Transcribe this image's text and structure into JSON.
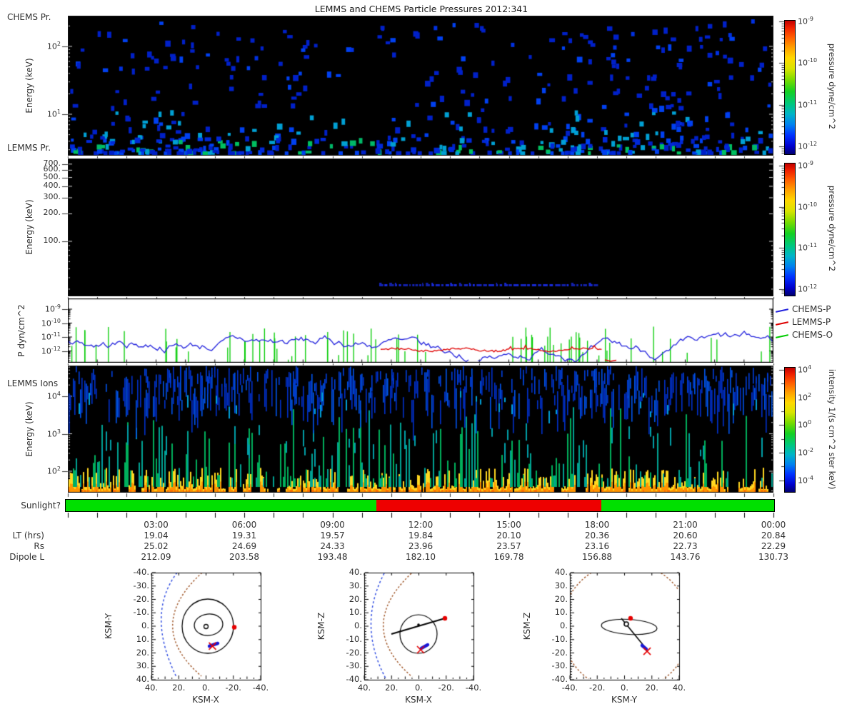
{
  "title": "LEMMS and CHEMS Particle Pressures  2012:341",
  "panels": {
    "p1": {
      "name": "CHEMS Pr.",
      "ylabel": "Energy (keV)",
      "yticks": [
        {
          "label": "10^2",
          "lg": 2
        },
        {
          "label": "10^1",
          "lg": 1
        }
      ]
    },
    "p2": {
      "name": "LEMMS Pr.",
      "ylabel": "Energy (keV)",
      "yticks": [
        {
          "label": "700.",
          "E": 700
        },
        {
          "label": "600.",
          "E": 600
        },
        {
          "label": "500.",
          "E": 500
        },
        {
          "label": "400.",
          "E": 400
        },
        {
          "label": "300.",
          "E": 300
        },
        {
          "label": "200.",
          "E": 200
        },
        {
          "label": "100.",
          "E": 100
        }
      ]
    },
    "p3": {
      "ylabel": "P dyn/cm^2",
      "yticks": [
        {
          "label": "10^-9",
          "lg": -9
        },
        {
          "label": "10^-10",
          "lg": -10
        },
        {
          "label": "10^-11",
          "lg": -11
        },
        {
          "label": "10^-12",
          "lg": -12
        }
      ],
      "legend": [
        {
          "label": "CHEMS-P",
          "color": "#2222dd"
        },
        {
          "label": "LEMMS-P",
          "color": "#dd0000"
        },
        {
          "label": "CHEMS-O",
          "color": "#00cc00"
        }
      ]
    },
    "p4": {
      "name": "LEMMS Ions",
      "ylabel": "Energy (keV)",
      "yticks": [
        {
          "label": "10^4",
          "lg": 4
        },
        {
          "label": "10^3",
          "lg": 3
        },
        {
          "label": "10^2",
          "lg": 2
        }
      ]
    }
  },
  "colorbars": {
    "cb1": {
      "label": "pressure dyne/cm^2",
      "ticks": [
        {
          "label": "10^-9",
          "lg": -9
        },
        {
          "label": "10^-10",
          "lg": -10
        },
        {
          "label": "10^-11",
          "lg": -11
        },
        {
          "label": "10^-12",
          "lg": -12
        }
      ]
    },
    "cb2": {
      "label": "pressure dyne/cm^2",
      "ticks": [
        {
          "label": "10^-9",
          "lg": -9
        },
        {
          "label": "10^-10",
          "lg": -10
        },
        {
          "label": "10^-11",
          "lg": -11
        },
        {
          "label": "10^-12",
          "lg": -12
        }
      ]
    },
    "cb4": {
      "label": "intensity 1/(s cm^2 ster keV)",
      "ticks": [
        {
          "label": "10^4",
          "lg": 4
        },
        {
          "label": "10^2",
          "lg": 2
        },
        {
          "label": "10^0",
          "lg": 0
        },
        {
          "label": "10^-2",
          "lg": -2
        },
        {
          "label": "10^-4",
          "lg": -4
        }
      ]
    }
  },
  "sunlight": {
    "label": "Sunlight?",
    "segments": [
      {
        "state": "sunlit",
        "color": "#00e000",
        "fromHour": 0,
        "toHour": 10.52
      },
      {
        "state": "shadow",
        "color": "#ee0000",
        "fromHour": 10.52,
        "toHour": 18.15
      },
      {
        "state": "sunlit",
        "color": "#00e000",
        "fromHour": 18.15,
        "toHour": 24
      }
    ]
  },
  "time_axis": {
    "row_labels": [
      "LT (hrs)",
      "Rs",
      "Dipole L"
    ],
    "columns": [
      {
        "hour": 3,
        "time": "03:00",
        "lt": "19.04",
        "rs": "25.02",
        "dipole_l": "212.09"
      },
      {
        "hour": 6,
        "time": "06:00",
        "lt": "19.31",
        "rs": "24.69",
        "dipole_l": "203.58"
      },
      {
        "hour": 9,
        "time": "09:00",
        "lt": "19.57",
        "rs": "24.33",
        "dipole_l": "193.48"
      },
      {
        "hour": 12,
        "time": "12:00",
        "lt": "19.84",
        "rs": "23.96",
        "dipole_l": "182.10"
      },
      {
        "hour": 15,
        "time": "15:00",
        "lt": "20.10",
        "rs": "23.57",
        "dipole_l": "169.78"
      },
      {
        "hour": 18,
        "time": "18:00",
        "lt": "20.36",
        "rs": "23.16",
        "dipole_l": "156.88"
      },
      {
        "hour": 21,
        "time": "21:00",
        "lt": "20.60",
        "rs": "22.73",
        "dipole_l": "143.76"
      },
      {
        "hour": 24,
        "time": "00:00",
        "lt": "20.84",
        "rs": "22.29",
        "dipole_l": "130.73"
      }
    ]
  },
  "orbits": [
    {
      "xlabel": "KSM-X",
      "ylabel": "KSM-Y",
      "xrange": [
        40,
        -40
      ],
      "yrange": [
        -40,
        40
      ],
      "xticks": [
        {
          "label": "40.",
          "v": 40
        },
        {
          "label": "20.",
          "v": 20
        },
        {
          "label": "0.",
          "v": 0
        },
        {
          "label": "-20.",
          "v": -20
        },
        {
          "label": "-40.",
          "v": -40
        }
      ],
      "yticks": [
        {
          "label": "-40.",
          "v": -40
        },
        {
          "label": "-30.",
          "v": -30
        },
        {
          "label": "-20.",
          "v": -20
        },
        {
          "label": "-10.",
          "v": -10
        },
        {
          "label": "0.",
          "v": 0
        },
        {
          "label": "10.",
          "v": 10
        },
        {
          "label": "20.",
          "v": 20
        },
        {
          "label": "30.",
          "v": 30
        },
        {
          "label": "40.",
          "v": 40
        }
      ],
      "markers": {
        "start_dot": [
          -20.7,
          0.8
        ],
        "cross": [
          -4.7,
          14.9
        ],
        "spacecraft_seg": [
          [
            -2.4,
            14.9
          ],
          [
            -8.6,
            12.8
          ]
        ]
      }
    },
    {
      "xlabel": "KSM-X",
      "ylabel": "KSM-Z",
      "xrange": [
        40,
        -40
      ],
      "yrange": [
        40,
        -40
      ],
      "xticks": [
        {
          "label": "40.",
          "v": 40
        },
        {
          "label": "20.",
          "v": 20
        },
        {
          "label": "0.",
          "v": 0
        },
        {
          "label": "-20.",
          "v": -20
        },
        {
          "label": "-40.",
          "v": -40
        }
      ],
      "yticks": [
        {
          "label": "40.",
          "v": 40
        },
        {
          "label": "30.",
          "v": 30
        },
        {
          "label": "20.",
          "v": 20
        },
        {
          "label": "10.",
          "v": 10
        },
        {
          "label": "0.",
          "v": 0
        },
        {
          "label": "-10.",
          "v": -10
        },
        {
          "label": "-20.",
          "v": -20
        },
        {
          "label": "-30.",
          "v": -30
        },
        {
          "label": "-40.",
          "v": -40
        }
      ],
      "markers": {
        "start_dot": [
          -19.1,
          5.9
        ],
        "cross": [
          -1.3,
          -17.6
        ],
        "spacecraft_seg": [
          [
            -1.8,
            -16.5
          ],
          [
            -6.5,
            -13.9
          ]
        ]
      }
    },
    {
      "xlabel": "KSM-Y",
      "ylabel": "KSM-Z",
      "xrange": [
        -40,
        40
      ],
      "yrange": [
        40,
        -40
      ],
      "xticks": [
        {
          "label": "-40.",
          "v": -40
        },
        {
          "label": "-20.",
          "v": -20
        },
        {
          "label": "0.",
          "v": 0
        },
        {
          "label": "20.",
          "v": 20
        },
        {
          "label": "40.",
          "v": 40
        }
      ],
      "yticks": [
        {
          "label": "40.",
          "v": 40
        },
        {
          "label": "30.",
          "v": 30
        },
        {
          "label": "20.",
          "v": 20
        },
        {
          "label": "10.",
          "v": 10
        },
        {
          "label": "0.",
          "v": 0
        },
        {
          "label": "-10.",
          "v": -10
        },
        {
          "label": "-20.",
          "v": -20
        },
        {
          "label": "-30.",
          "v": -30
        },
        {
          "label": "-40.",
          "v": -40
        }
      ],
      "markers": {
        "start_dot": [
          4.4,
          5.9
        ],
        "cross": [
          16.5,
          -18.7
        ],
        "spacecraft_seg": [
          [
            12.8,
            -14.4
          ],
          [
            15.9,
            -17.1
          ]
        ]
      }
    }
  ],
  "chart_data": [
    {
      "panel": "CHEMS Pr.",
      "type": "heatmap",
      "xlabel": "time 00:00-24:00 UT on 2012:341",
      "ylabel": "Energy (keV)",
      "y_scale": "log",
      "y_range_keV": [
        2.5,
        280
      ],
      "colorbar_label": "pressure dyne/cm^2",
      "colorbar_range_log10": [
        -12,
        -9
      ],
      "content": "sparse scattered pixels, mostly dark blue near 1e-12 with some cyan and green up to ~1e-11; density highest below ~10 keV; clusters around 01:00-08:00, 10:00-15:00 and 16:30-24:00 with gaps near 08:00-10:00 and 14:30-16:30"
    },
    {
      "panel": "LEMMS Pr.",
      "type": "heatmap",
      "ylabel": "Energy (keV)",
      "y_scale": "log",
      "y_ticks_keV": [
        700,
        600,
        500,
        400,
        300,
        200,
        100
      ],
      "colorbar_label": "pressure dyne/cm^2",
      "colorbar_range_log10": [
        -12,
        -9
      ],
      "content": "black (no data) except a horizontal dashed blue (~1e-12) trace in the lowest-energy channel from about 10:35 to 18:05"
    },
    {
      "panel": "P dyn/cm^2",
      "type": "line",
      "y_scale": "log",
      "y_range_log10": [
        -12.8,
        -9
      ],
      "series": [
        {
          "name": "CHEMS-P",
          "color": "blue",
          "summary": "noisy trace fluctuating ~1e-12 to ~1e-11 across the whole day with dropout gaps, sparsest 11:30-14:30"
        },
        {
          "name": "LEMMS-P",
          "color": "red",
          "summary": "flat noisy trace near 1e-12 only between ~10:40 and ~18:20"
        },
        {
          "name": "CHEMS-O",
          "color": "green",
          "summary": "isolated vertical spikes reaching ~3e-11 to 6e-11, densest 00:00-09:00 and 11:00-17:00"
        }
      ]
    },
    {
      "panel": "LEMMS Ions",
      "type": "heatmap",
      "ylabel": "Energy (keV)",
      "y_scale": "log",
      "y_range_keV": [
        30,
        65000
      ],
      "colorbar_label": "intensity 1/(s cm^2 ster keV)",
      "colorbar_range_log10": [
        -5,
        4
      ],
      "content": "dense 1-2 px vertical striations: blue segments above ~2000 keV, teal/green spikes at mid energies, and a quasi-continuous yellow-orange high-intensity band below ~100 keV"
    },
    {
      "panel": "Sunlight?",
      "type": "bar",
      "segments": [
        {
          "value": "sunlit",
          "from": "00:00",
          "to": "~10:30",
          "color": "green"
        },
        {
          "value": "shadow",
          "from": "~10:30",
          "to": "~18:10",
          "color": "red"
        },
        {
          "value": "sunlit",
          "from": "~18:10",
          "to": "24:00",
          "color": "green"
        }
      ]
    },
    {
      "panel": "ephemeris",
      "type": "table",
      "columns": [
        "03:00",
        "06:00",
        "09:00",
        "12:00",
        "15:00",
        "18:00",
        "21:00",
        "00:00"
      ],
      "rows": [
        {
          "label": "LT (hrs)",
          "values": [
            19.04,
            19.31,
            19.57,
            19.84,
            20.1,
            20.36,
            20.6,
            20.84
          ]
        },
        {
          "label": "Rs",
          "values": [
            25.02,
            24.69,
            24.33,
            23.96,
            23.57,
            23.16,
            22.73,
            22.29
          ]
        },
        {
          "label": "Dipole L",
          "values": [
            212.09,
            203.58,
            193.48,
            182.1,
            169.78,
            156.88,
            143.76,
            130.73
          ]
        }
      ]
    },
    {
      "panel": "orbit KSM-X vs KSM-Y",
      "type": "scatter",
      "x_range": [
        40,
        -40
      ],
      "y_range": [
        -40,
        40
      ],
      "content": "black spiral orbit around Saturn at origin, dashed blue bow-shock arc (nose near x=33) and dashed brown magnetopause arc (nose near x=24); red start dot at (-20.7, 0.8); thick blue spacecraft segment with red X near (-4.7, 14.9)"
    },
    {
      "panel": "orbit KSM-X vs KSM-Z",
      "type": "scatter",
      "x_range": [
        40,
        -40
      ],
      "y_range": [
        40,
        -40
      ],
      "content": "orbit seen nearly edge-on: black line through Saturn plus open loop, dashed blue and brown boundary arcs at left; red start dot at (-19.1, 5.9); blue spacecraft segment with red X near (-1.3, -17.6)"
    },
    {
      "panel": "orbit KSM-Y vs KSM-Z",
      "type": "scatter",
      "x_range": [
        -40,
        40
      ],
      "y_range": [
        40,
        -40
      ],
      "content": "flattened black ellipse through origin with line to spacecraft; dashed brown magnetopause arcs at the four corners; red start dot at (4.4, 5.9); blue spacecraft segment with red X near (16.5, -18.7)"
    }
  ]
}
